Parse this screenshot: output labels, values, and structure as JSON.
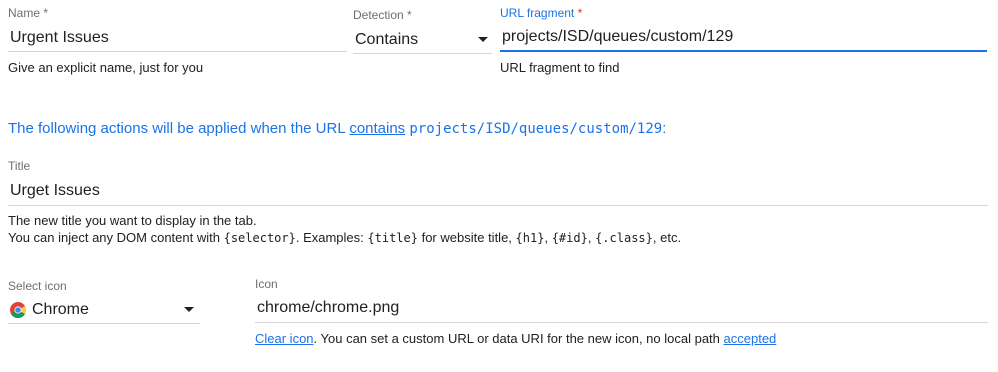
{
  "name_field": {
    "label": "Name",
    "required_mark": "*",
    "value": "Urgent Issues",
    "help": "Give an explicit name, just for you"
  },
  "detection_field": {
    "label": "Detection",
    "required_mark": "*",
    "value": "Contains"
  },
  "url_field": {
    "label": "URL fragment",
    "required_mark": "*",
    "value": "projects/ISD/queues/custom/129",
    "help": "URL fragment to find"
  },
  "summary": {
    "prefix": "The following actions will be applied when the URL",
    "link": "contains",
    "code": "projects/ISD/queues/custom/129",
    "suffix": ":"
  },
  "title_field": {
    "label": "Title",
    "value": "Urget Issues",
    "help_line1": "The new title you want to display in the tab.",
    "help_line2_a": "You can inject any DOM content with",
    "code_selector": "{selector}",
    "help_line2_b": ". Examples:",
    "code_title": "{title}",
    "help_line2_c": "for website title,",
    "code_h1": "{h1}",
    "sep1": ",",
    "code_id": "{#id}",
    "sep2": ",",
    "code_class": "{.class}",
    "help_line2_d": ", etc."
  },
  "select_icon": {
    "label": "Select icon",
    "value": "Chrome",
    "icon": "chrome-icon"
  },
  "icon_field": {
    "label": "Icon",
    "value": "chrome/chrome.png",
    "clear_link": "Clear icon",
    "help_mid": ". You can set a custom URL or data URI for the new icon, no local path",
    "accepted_link": "accepted"
  },
  "colors": {
    "accent": "#1a73e8",
    "required": "#d93025"
  }
}
